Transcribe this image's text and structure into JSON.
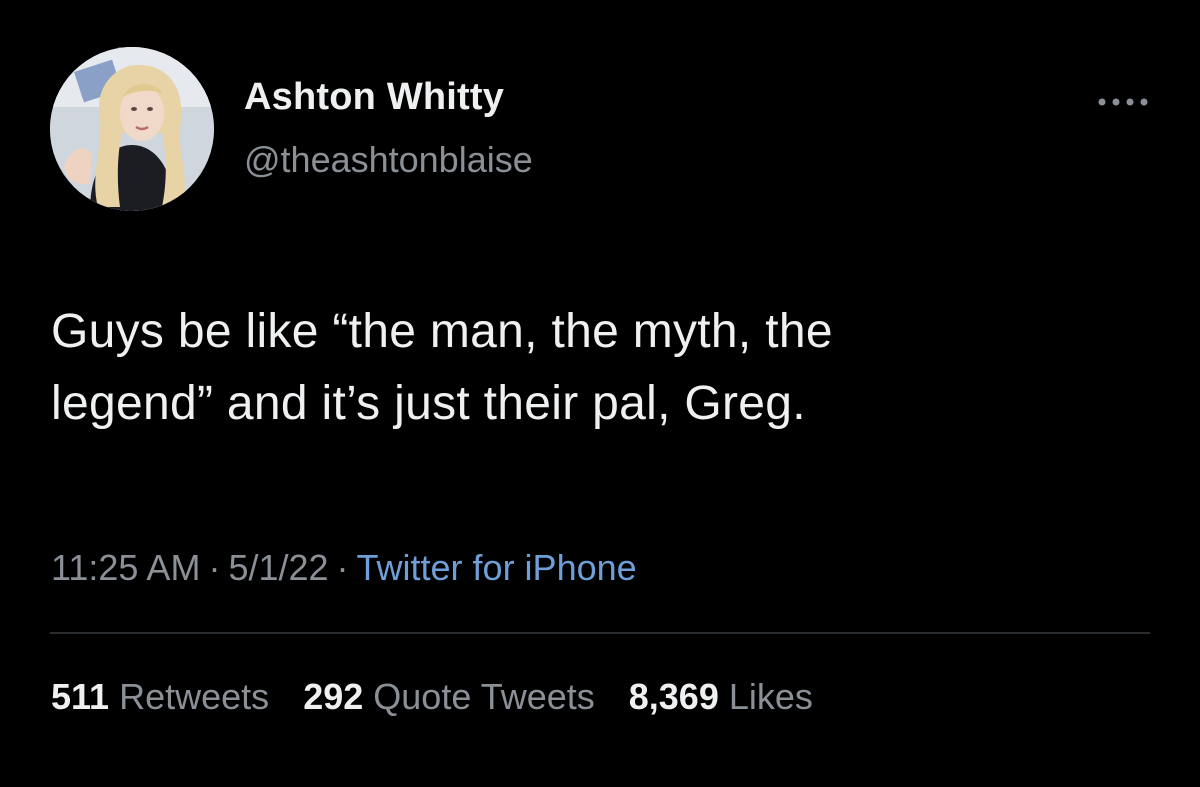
{
  "author": {
    "display_name": "Ashton Whitty",
    "handle": "@theashtonblaise"
  },
  "tweet": {
    "text_line_1": "Guys be like “the man, the myth, the",
    "text_line_2": "legend” and it’s just their pal, Greg."
  },
  "meta": {
    "time": "11:25 AM",
    "separator": "·",
    "date": "5/1/22",
    "source": "Twitter for iPhone"
  },
  "stats": {
    "retweets_count": "511",
    "retweets_label": "Retweets",
    "quotes_count": "292",
    "quotes_label": "Quote Tweets",
    "likes_count": "8,369",
    "likes_label": "Likes"
  },
  "icons": {
    "more": "more-horizontal-icon",
    "avatar": "profile-avatar"
  },
  "colors": {
    "background": "#000000",
    "primary_text": "#eef0f2",
    "secondary_text": "#8b9096",
    "link": "#6f9fd8"
  }
}
